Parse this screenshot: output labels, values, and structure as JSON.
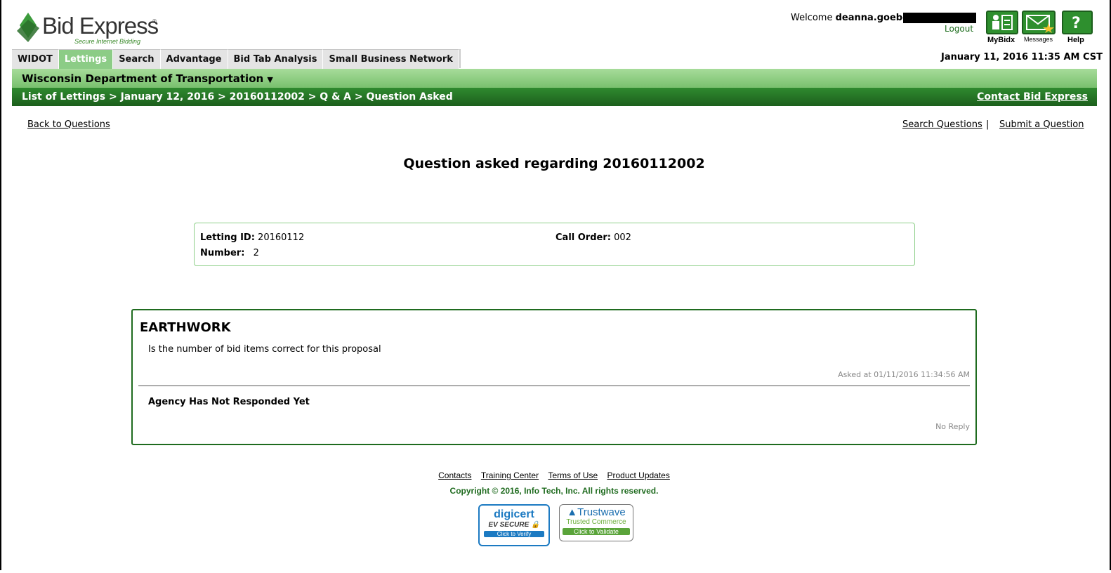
{
  "header": {
    "logo_text": "Bid Express",
    "logo_tagline": "Secure Internet Bidding",
    "welcome_prefix": "Welcome",
    "username": "deanna.goebel",
    "logout": "Logout",
    "icons": [
      {
        "name": "mybidx-icon",
        "label": "MyBidx"
      },
      {
        "name": "messages-icon",
        "label": "Messages"
      },
      {
        "name": "help-icon",
        "label": "Help"
      }
    ],
    "datetime": "January 11, 2016 11:35 AM CST"
  },
  "tabs": [
    "WIDOT",
    "Lettings",
    "Search",
    "Advantage",
    "Bid Tab Analysis",
    "Small Business Network"
  ],
  "active_tab": "Lettings",
  "agency_bar": {
    "label": "Wisconsin Department of Transportation",
    "dropdown_icon": "caret-down-icon"
  },
  "breadcrumb": {
    "path": "List of Lettings > January 12, 2016 > 20160112002 > Q & A > Question Asked",
    "contact": "Contact Bid Express"
  },
  "links": {
    "back": "Back to Questions",
    "search": "Search Questions",
    "separator": "|",
    "submit": "Submit a Question"
  },
  "page_title": "Question asked regarding 20160112002",
  "info": {
    "letting_id_label": "Letting ID:",
    "letting_id": "20160112",
    "call_order_label": "Call Order:",
    "call_order": "002",
    "number_label": "Number:",
    "number": "2"
  },
  "question": {
    "subject": "EARTHWORK",
    "text": "Is the number of bid items correct for this proposal",
    "asked_at": "Asked at 01/11/2016 11:34:56 AM",
    "response": "Agency Has Not Responded Yet",
    "reply_status": "No Reply"
  },
  "footer": {
    "links": [
      "Contacts",
      "Training Center",
      "Terms of Use",
      "Product Updates"
    ],
    "copyright": "Copyright © 2016, Info Tech, Inc. All rights reserved."
  },
  "badges": {
    "digicert": {
      "brand": "digicert",
      "line": "EV SECURE",
      "cta": "Click to Verify"
    },
    "trustwave": {
      "brand": "Trustwave",
      "line": "Trusted Commerce",
      "cta": "Click to Validate"
    }
  },
  "colors": {
    "green_dark": "#1c5f1c",
    "green_light": "#8ccc86",
    "link": "#000000"
  }
}
